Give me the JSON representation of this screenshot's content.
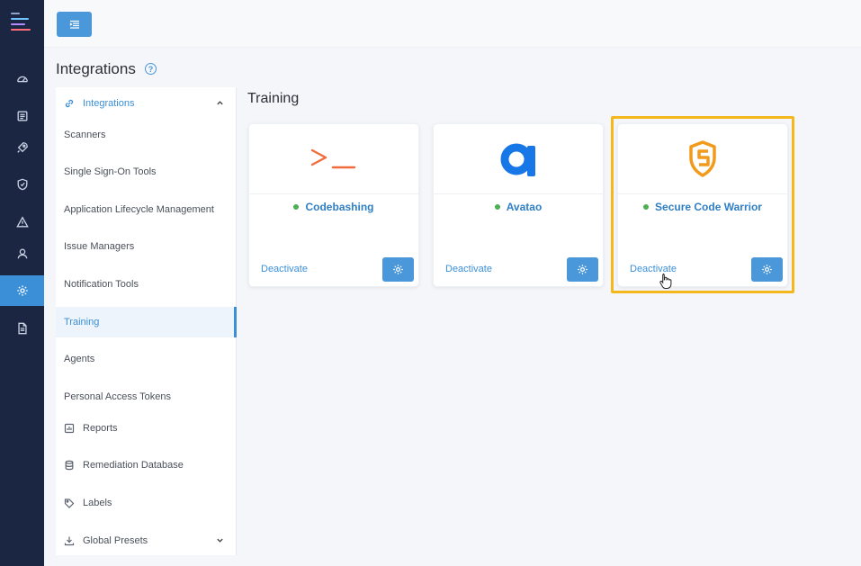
{
  "rail": {
    "items": [
      {
        "icon": "dashboard-icon"
      },
      {
        "icon": "list-icon"
      },
      {
        "icon": "rocket-icon"
      },
      {
        "icon": "shield-icon"
      },
      {
        "icon": "warning-icon"
      },
      {
        "icon": "user-icon"
      },
      {
        "icon": "gear-icon",
        "active": true
      },
      {
        "icon": "document-icon"
      }
    ]
  },
  "page": {
    "title": "Integrations",
    "help": "?"
  },
  "subnav": {
    "group_label": "Integrations",
    "items": [
      "Scanners",
      "Single Sign-On Tools",
      "Application Lifecycle Management",
      "Issue Managers",
      "Notification Tools",
      "Training",
      "Agents",
      "Personal Access Tokens"
    ],
    "active": "Training",
    "extra": {
      "reports": "Reports",
      "remediation": "Remediation Database",
      "labels": "Labels",
      "presets": "Global Presets"
    }
  },
  "main": {
    "section_title": "Training",
    "cards": [
      {
        "name": "Codebashing",
        "status": "active",
        "action": "Deactivate",
        "logo": "terminal-prompt-logo"
      },
      {
        "name": "Avatao",
        "status": "active",
        "action": "Deactivate",
        "logo": "avatao-a-logo"
      },
      {
        "name": "Secure Code Warrior",
        "status": "active",
        "action": "Deactivate",
        "logo": "scw-shield-logo",
        "highlighted": true
      }
    ]
  },
  "colors": {
    "rail": "#1b2742",
    "accent": "#3a8fd6",
    "status_active": "#4caf50",
    "highlight": "#f4b81c",
    "codebashing": "#f26b3a",
    "avatao": "#1877e6",
    "scw": "#f29a1b"
  }
}
